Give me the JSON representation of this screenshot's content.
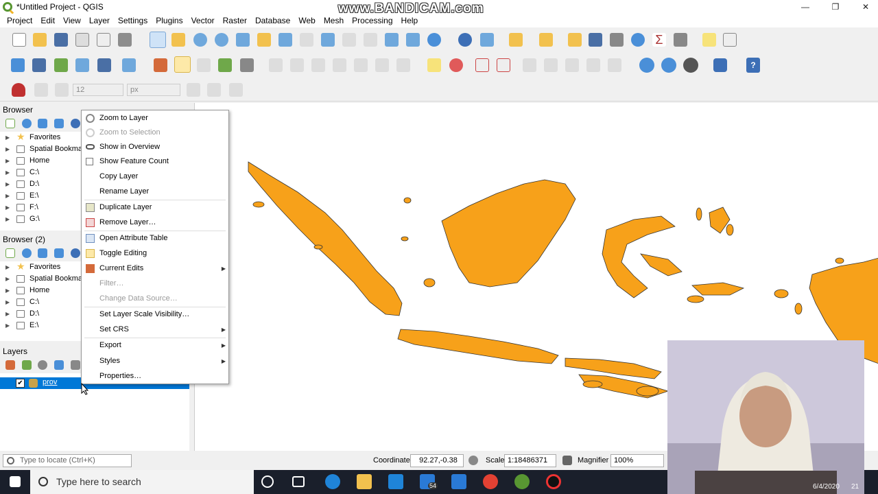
{
  "window": {
    "title": "*Untitled Project - QGIS",
    "watermark": "www.BANDICAM.com",
    "controls": {
      "minimize": "—",
      "restore": "❐",
      "close": "✕"
    }
  },
  "menubar": {
    "items": [
      "Project",
      "Edit",
      "View",
      "Layer",
      "Settings",
      "Plugins",
      "Vector",
      "Raster",
      "Database",
      "Web",
      "Mesh",
      "Processing",
      "Help"
    ]
  },
  "snapping": {
    "tolerance": "12",
    "unit": "px"
  },
  "browser": {
    "title": "Browser",
    "items": [
      {
        "label": "Favorites",
        "icon": "star-icon"
      },
      {
        "label": "Spatial Bookmarks",
        "icon": "bookmark-icon"
      },
      {
        "label": "Home",
        "icon": "home-icon"
      },
      {
        "label": "C:\\",
        "icon": "folder-icon"
      },
      {
        "label": "D:\\",
        "icon": "folder-icon"
      },
      {
        "label": "E:\\",
        "icon": "folder-icon"
      },
      {
        "label": "F:\\",
        "icon": "folder-icon"
      },
      {
        "label": "G:\\",
        "icon": "folder-icon"
      }
    ]
  },
  "browser2": {
    "title": "Browser (2)",
    "items": [
      {
        "label": "Favorites",
        "icon": "star-icon"
      },
      {
        "label": "Spatial Bookmarks",
        "icon": "bookmark-icon"
      },
      {
        "label": "Home",
        "icon": "home-icon"
      },
      {
        "label": "C:\\",
        "icon": "folder-icon"
      },
      {
        "label": "D:\\",
        "icon": "folder-icon"
      },
      {
        "label": "E:\\",
        "icon": "folder-icon"
      }
    ]
  },
  "layers": {
    "title": "Layers",
    "items": [
      {
        "label": "prov",
        "checked": true
      }
    ]
  },
  "context_menu": {
    "items": [
      {
        "label": "Zoom to Layer",
        "enabled": true
      },
      {
        "label": "Zoom to Selection",
        "enabled": false
      },
      {
        "label": "Show in Overview",
        "enabled": true
      },
      {
        "label": "Show Feature Count",
        "enabled": true
      },
      {
        "label": "Copy Layer",
        "enabled": true
      },
      {
        "label": "Rename Layer",
        "enabled": true
      },
      {
        "label": "Duplicate Layer",
        "enabled": true
      },
      {
        "label": "Remove Layer…",
        "enabled": true
      },
      {
        "label": "Open Attribute Table",
        "enabled": true
      },
      {
        "label": "Toggle Editing",
        "enabled": true
      },
      {
        "label": "Current Edits",
        "enabled": true,
        "submenu": true
      },
      {
        "label": "Filter…",
        "enabled": false
      },
      {
        "label": "Change Data Source…",
        "enabled": false
      },
      {
        "label": "Set Layer Scale Visibility…",
        "enabled": true
      },
      {
        "label": "Set CRS",
        "enabled": true,
        "submenu": true
      },
      {
        "label": "Export",
        "enabled": true,
        "submenu": true
      },
      {
        "label": "Styles",
        "enabled": true,
        "submenu": true
      },
      {
        "label": "Properties…",
        "enabled": true
      }
    ]
  },
  "statusbar": {
    "locate_placeholder": "Type to locate (Ctrl+K)",
    "coordinate_label": "Coordinate",
    "coordinate_value": "92.27,-0.38",
    "scale_label": "Scale",
    "scale_value": "1:18486371",
    "magnifier_label": "Magnifier",
    "magnifier_value": "100%"
  },
  "taskbar": {
    "search_placeholder": "Type here to search",
    "mail_badge": "54",
    "date": "6/4/2020",
    "notification_count": "21"
  },
  "colors": {
    "map_fill": "#f7a11a",
    "selection": "#0078d7"
  }
}
